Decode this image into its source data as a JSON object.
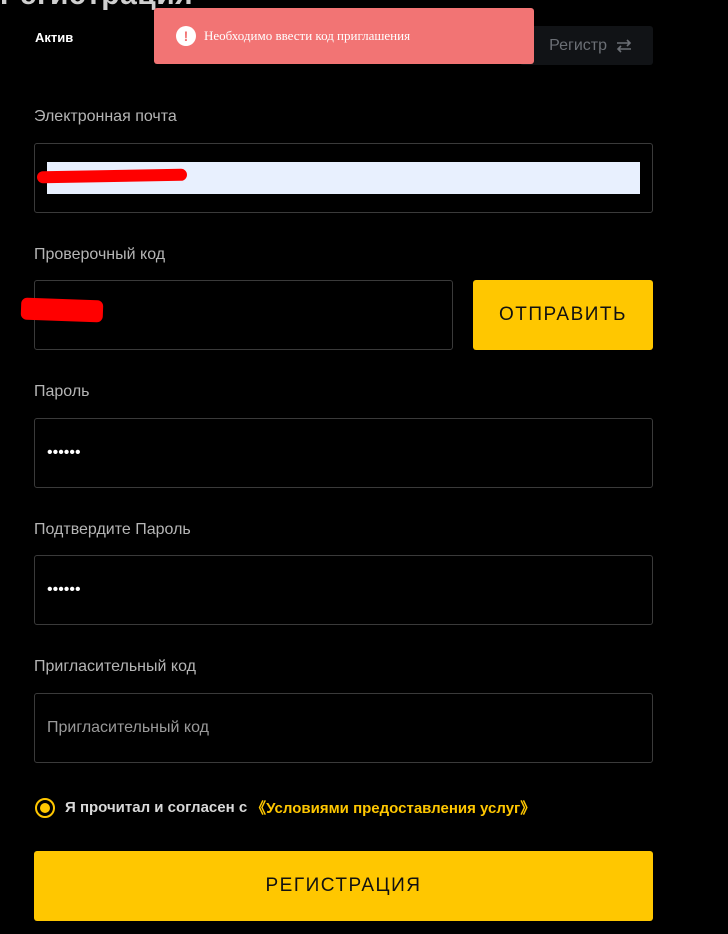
{
  "page": {
    "title": "Регистрация"
  },
  "header": {
    "active_tab": "Актив",
    "switch_label": "Регистр",
    "switch_icon": "swap-arrows-icon"
  },
  "toast": {
    "message": "Необходимо ввести код приглашения",
    "icon": "exclamation-icon",
    "color": "#f27474"
  },
  "form": {
    "email": {
      "label": "Электронная почта",
      "value": ""
    },
    "verification": {
      "label": "Проверочный код",
      "value": "",
      "send_label": "ОТПРАВИТЬ"
    },
    "password": {
      "label": "Пароль",
      "value": "••••••"
    },
    "confirm_password": {
      "label": "Подтвердите Пароль",
      "value": "••••••"
    },
    "invite": {
      "label": "Пригласительный код",
      "placeholder": "Пригласительный код",
      "value": ""
    },
    "agreement": {
      "text": "Я прочитал и согласен с",
      "link": "《Условиями предоставления услуг》",
      "checked": true
    },
    "submit_label": "РЕГИСТРАЦИЯ"
  },
  "colors": {
    "accent": "#ffc700",
    "background": "#000000",
    "error": "#f27474"
  }
}
